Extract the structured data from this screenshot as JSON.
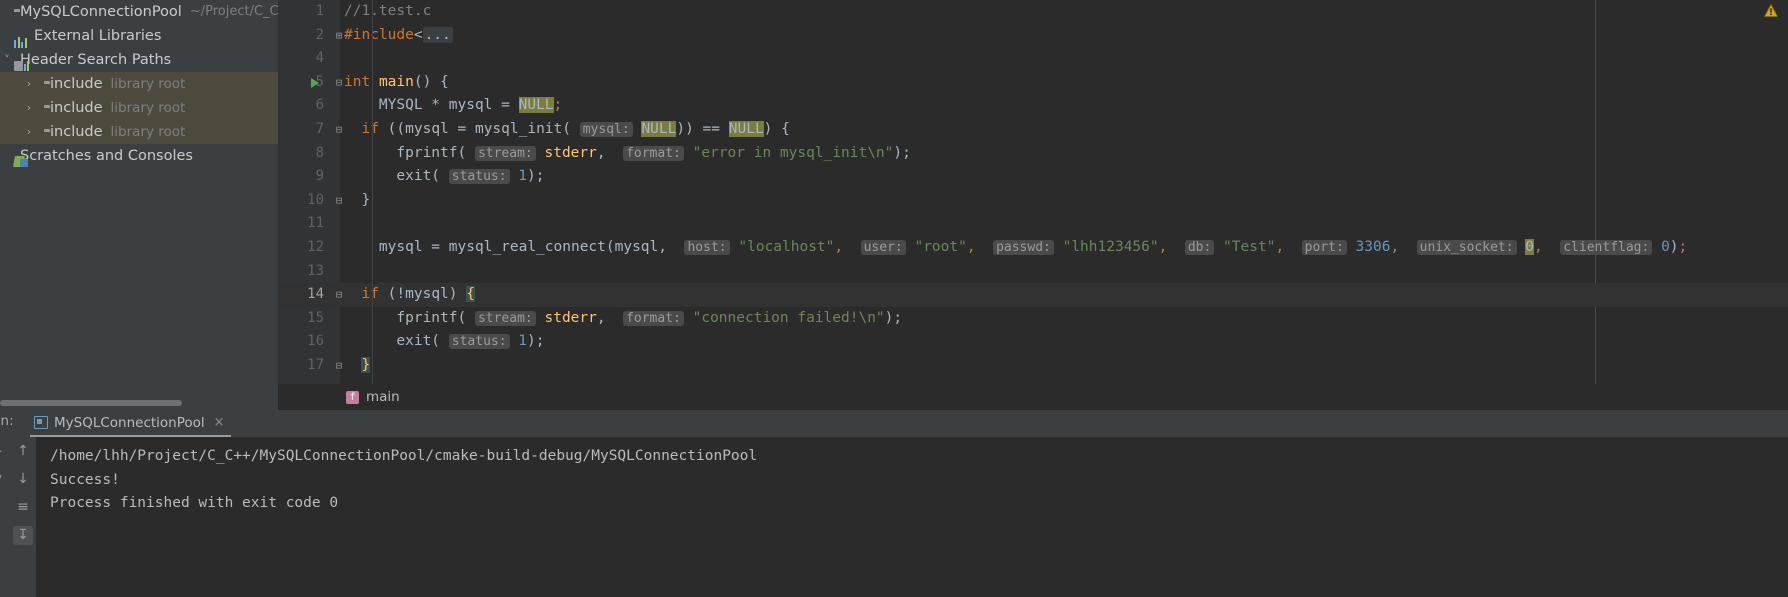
{
  "sidebar": {
    "rows": [
      {
        "indent": 0,
        "arrow": "",
        "icon": "folder-icon",
        "label": "MySQLConnectionPool",
        "sub": "~/Project/C_C++/M",
        "selected": false
      },
      {
        "indent": 0,
        "arrow": "",
        "icon": "external-libraries-icon",
        "label": "External Libraries",
        "sub": "",
        "selected": false
      },
      {
        "indent": 0,
        "arrow": "˅",
        "icon": "header-search-paths-icon",
        "label": "Header Search Paths",
        "sub": "",
        "selected": false
      },
      {
        "indent": 1,
        "arrow": "›",
        "icon": "folder-icon",
        "label": "include",
        "sub": "library root",
        "selected": true
      },
      {
        "indent": 1,
        "arrow": "›",
        "icon": "folder-icon",
        "label": "include",
        "sub": "library root",
        "selected": true
      },
      {
        "indent": 1,
        "arrow": "›",
        "icon": "folder-icon",
        "label": "include",
        "sub": "library root",
        "selected": true
      },
      {
        "indent": 0,
        "arrow": "",
        "icon": "scratches-icon",
        "label": "Scratches and Consoles",
        "sub": "",
        "selected": false
      }
    ]
  },
  "editor": {
    "warning_icon": "warning-triangle-icon",
    "lines": [
      {
        "num": "1",
        "fold": "",
        "run": false,
        "caret": false
      },
      {
        "num": "2",
        "fold": "⊞",
        "run": false,
        "caret": false
      },
      {
        "num": "4",
        "fold": "",
        "run": false,
        "caret": false
      },
      {
        "num": "5",
        "fold": "⊟",
        "run": true,
        "caret": false
      },
      {
        "num": "6",
        "fold": "",
        "run": false,
        "caret": false
      },
      {
        "num": "7",
        "fold": "⊟",
        "run": false,
        "caret": false
      },
      {
        "num": "8",
        "fold": "",
        "run": false,
        "caret": false
      },
      {
        "num": "9",
        "fold": "",
        "run": false,
        "caret": false
      },
      {
        "num": "10",
        "fold": "⊟",
        "run": false,
        "caret": false
      },
      {
        "num": "11",
        "fold": "",
        "run": false,
        "caret": false
      },
      {
        "num": "12",
        "fold": "",
        "run": false,
        "caret": false
      },
      {
        "num": "13",
        "fold": "",
        "run": false,
        "caret": false
      },
      {
        "num": "14",
        "fold": "⊟",
        "run": false,
        "caret": true
      },
      {
        "num": "15",
        "fold": "",
        "run": false,
        "caret": false
      },
      {
        "num": "16",
        "fold": "",
        "run": false,
        "caret": false
      },
      {
        "num": "17",
        "fold": "⊟",
        "run": false,
        "caret": false
      }
    ],
    "source_text": [
      "//1.test.c",
      "#include<...",
      "",
      "int main() {",
      "    MYSQL * mysql = NULL;",
      "  if ((mysql = mysql_init( mysql: NULL)) == NULL) {",
      "      fprintf( stream: stderr,  format: \"error in mysql_init\\n\");",
      "      exit( status: 1);",
      "  }",
      "",
      "    mysql = mysql_real_connect(mysql,  host: \"localhost\",  user: \"root\",  passwd: \"lhh123456\",  db: \"Test\",  port: 3306,  unix_socket: 0,  clientflag: 0);",
      "",
      "  if (!mysql) {",
      "      fprintf( stream: stderr,  format: \"connection failed!\\n\");",
      "      exit( status: 1);",
      "  }"
    ]
  },
  "breadcrumb": {
    "badge": "f",
    "label": "main"
  },
  "run_panel": {
    "run_label": "un:",
    "tab_icon": "run-configuration-icon",
    "tab_title": "MySQLConnectionPool",
    "tab_close": "×",
    "toolbar": [
      {
        "name": "scroll-up-button",
        "glyph": "↑",
        "active": false
      },
      {
        "name": "scroll-down-button",
        "glyph": "↓",
        "active": false
      },
      {
        "name": "soft-wrap-button",
        "glyph": "≡",
        "active": false
      },
      {
        "name": "scroll-to-end-button",
        "glyph": "↧",
        "active": true
      }
    ],
    "rail": [
      {
        "name": "rerun-button",
        "glyph": "▸"
      },
      {
        "name": "stop-button",
        "glyph": "▾"
      }
    ],
    "console_lines": [
      "/home/lhh/Project/C_C++/MySQLConnectionPool/cmake-build-debug/MySQLConnectionPool",
      "Success!",
      "",
      "Process finished with exit code 0"
    ]
  },
  "colors": {
    "editor_bg": "#2b2b2b",
    "panel_bg": "#3c3f41",
    "gutter_bg": "#313335",
    "selection": "#4e4a3d",
    "keyword": "#cc7832",
    "string": "#6a8759",
    "number": "#6897bb",
    "function": "#ffc66d",
    "comment": "#808080",
    "highlight": "#7c7c3e",
    "accent_run": "#56a451",
    "warning": "#d4a22b"
  }
}
